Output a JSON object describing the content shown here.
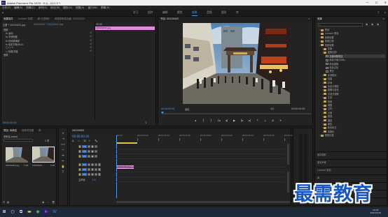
{
  "window": {
    "app_logo": "Pr",
    "title": "Adobe Premiere Pro 2020 - E:\\\\...\\\\11.5 *",
    "buttons": [
      "—",
      "☐",
      "✕"
    ]
  },
  "menu": [
    "文件(F)",
    "编辑(E)",
    "剪辑(C)",
    "序列(S)",
    "标记(M)",
    "图形(G)",
    "视图(V)",
    "窗口(W)",
    "帮助(H)"
  ],
  "workspaces": [
    {
      "label": "学习",
      "active": false
    },
    {
      "label": "组件",
      "active": false
    },
    {
      "label": "编辑",
      "active": false
    },
    {
      "label": "颜色",
      "active": false
    },
    {
      "label": "效果",
      "active": true
    },
    {
      "label": "音频",
      "active": false
    },
    {
      "label": "图形",
      "active": false
    },
    {
      "label": "库",
      "active": false
    }
  ],
  "effect_controls": {
    "tabs": [
      "效果控件",
      "Lumetri 范围",
      "源:(无剪辑)",
      "音频剪辑混合器: 20220422"
    ],
    "source_line": "主要 * 20220422.jpg",
    "seq_line": "20220422 * 20220422.jpg",
    "time_label": "00:00",
    "clip_label": "20220422.jpg",
    "rows": [
      "视频",
      "fx 运动",
      "fx 不透明度",
      "fx 时间重映射",
      "fx 色彩平衡(HLS)",
      "◯ □ ✎",
      "○ 色相/亮度",
      "音频"
    ],
    "timecode": "00:00:00:00"
  },
  "program": {
    "tab": "节目: 20220422",
    "timecode_left": "00:00:00:00",
    "fit": "适合",
    "ratio": "1/2",
    "timecode_right": "00:00:05:00",
    "controls": [
      "◂",
      "{",
      "}",
      "|◂",
      "◂|",
      "▶",
      "|▸",
      "▸|",
      "⇡",
      "⇣",
      "⊡",
      "+"
    ]
  },
  "effects_panel": {
    "tab": "效果",
    "search_placeholder": "",
    "tree": [
      {
        "label": "预设",
        "type": "folder",
        "indent": 1
      },
      {
        "label": "Lumetri 预设",
        "type": "folder",
        "indent": 1
      },
      {
        "label": "音频效果",
        "type": "folder",
        "indent": 1
      },
      {
        "label": "音频过渡",
        "type": "folder",
        "indent": 1
      },
      {
        "label": "视频效果",
        "type": "folder",
        "indent": 1
      },
      {
        "label": "变换",
        "type": "folder",
        "indent": 2
      },
      {
        "label": "图像控制",
        "type": "folder",
        "indent": 2
      },
      {
        "label": "灰度系数校正",
        "type": "effect",
        "indent": 3,
        "selected": true
      },
      {
        "label": "颜色平衡(RGB)",
        "type": "effect",
        "indent": 3
      },
      {
        "label": "颜色替换",
        "type": "effect",
        "indent": 3
      },
      {
        "label": "颜色过滤",
        "type": "effect",
        "indent": 3
      },
      {
        "label": "黑白",
        "type": "effect",
        "indent": 3
      },
      {
        "label": "实用程序",
        "type": "folder",
        "indent": 2
      },
      {
        "label": "扭曲",
        "type": "folder",
        "indent": 2
      },
      {
        "label": "时间",
        "type": "folder",
        "indent": 2
      },
      {
        "label": "杂色与颗粒",
        "type": "folder",
        "indent": 2
      },
      {
        "label": "模糊与锐化",
        "type": "folder",
        "indent": 2
      },
      {
        "label": "沉浸式视频",
        "type": "folder",
        "indent": 2
      },
      {
        "label": "生成",
        "type": "folder",
        "indent": 2
      },
      {
        "label": "视频",
        "type": "folder",
        "indent": 2
      },
      {
        "label": "调整",
        "type": "folder",
        "indent": 2
      },
      {
        "label": "过时",
        "type": "folder",
        "indent": 2
      },
      {
        "label": "过渡",
        "type": "folder",
        "indent": 2
      },
      {
        "label": "透视",
        "type": "folder",
        "indent": 2
      },
      {
        "label": "通道",
        "type": "folder",
        "indent": 2
      },
      {
        "label": "键控",
        "type": "folder",
        "indent": 2
      },
      {
        "label": "颜色校正",
        "type": "folder",
        "indent": 2
      },
      {
        "label": "风格化",
        "type": "folder",
        "indent": 2
      },
      {
        "label": "视频过渡",
        "type": "folder",
        "indent": 1
      }
    ],
    "sections": [
      "基本图形",
      "基本声音",
      "Lumetri 颜色",
      "库",
      "标记",
      "历史记录",
      "信息"
    ]
  },
  "project": {
    "tabs": [
      "项目: 未命名",
      "媒体浏览器",
      "库"
    ],
    "file": "未命名.prproj",
    "count": "2 项",
    "items": [
      {
        "name": "20220422.jpg",
        "duration": "5:00"
      },
      {
        "name": "20220422",
        "duration": "5:00"
      }
    ]
  },
  "timeline": {
    "tab": "20220422",
    "timecode": "00:00:00:00",
    "ruler": [
      ":00:00",
      "00:00:05:00",
      "00:00:10:00",
      "00:00:15:00",
      "00:00:20:00",
      "00:00:25:00",
      "00:00:30:00",
      "00:00:35:00",
      "00:00:40:00"
    ],
    "tracks": [
      {
        "name": "V3",
        "kind": "video"
      },
      {
        "name": "V2",
        "kind": "video"
      },
      {
        "name": "V1",
        "kind": "video"
      },
      {
        "name": "A1",
        "kind": "audio"
      },
      {
        "name": "A2",
        "kind": "audio"
      },
      {
        "name": "A3",
        "kind": "audio"
      },
      {
        "name": "主声道",
        "kind": "master",
        "value": "0.0"
      }
    ],
    "clip": "20220422.jpg"
  },
  "taskbar": {
    "time": "19:02",
    "date": "2022/5/26"
  },
  "watermark": "最需教育"
}
